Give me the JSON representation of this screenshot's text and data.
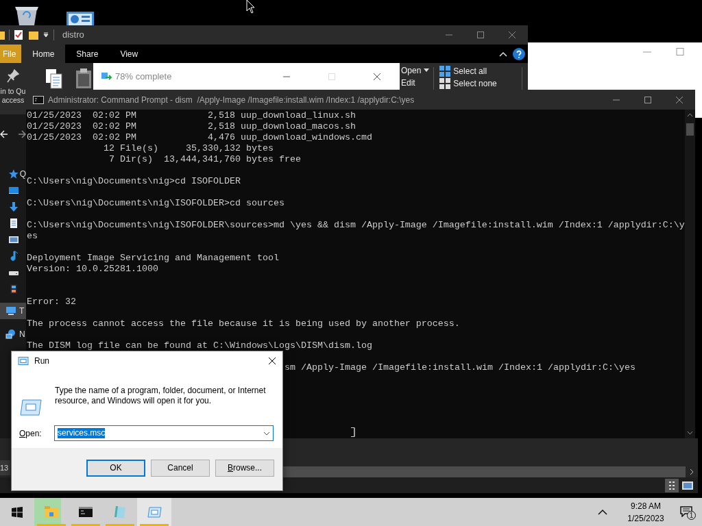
{
  "explorer": {
    "title": "distro",
    "tabs": [
      {
        "label": "File",
        "kind": "file",
        "selected": false
      },
      {
        "label": "Home",
        "kind": "tab",
        "selected": true
      },
      {
        "label": "Share",
        "kind": "tab",
        "selected": false
      },
      {
        "label": "View",
        "kind": "tab",
        "selected": false
      }
    ],
    "ribbon": {
      "pin_label": "in to Qu\naccess",
      "open": "Open",
      "edit": "Edit",
      "select_all": "Select all",
      "select_none": "Select none"
    },
    "nav_items": [
      {
        "kind": "star",
        "label": "Q",
        "selected": false
      },
      {
        "kind": "desktop",
        "selected": false
      },
      {
        "kind": "download",
        "selected": false
      },
      {
        "kind": "document",
        "selected": false
      },
      {
        "kind": "picture",
        "selected": false
      },
      {
        "kind": "music",
        "selected": false
      },
      {
        "kind": "drive",
        "selected": false
      },
      {
        "kind": "video",
        "selected": false
      },
      {
        "kind": "pc",
        "label": "T",
        "selected": true
      },
      {
        "kind": "network",
        "label": "N",
        "selected": false
      }
    ]
  },
  "file_window": {
    "item_count": "13"
  },
  "progress_dialog": {
    "title": "78% complete"
  },
  "cmd": {
    "title": "Administrator: Command Prompt - dism  /Apply-Image /Imagefile:install.wim /Index:1 /applydir:C:\\yes",
    "output": "01/25/2023  02:02 PM             2,518 uup_download_linux.sh\n01/25/2023  02:02 PM             2,518 uup_download_macos.sh\n01/25/2023  02:02 PM             4,476 uup_download_windows.cmd\n              12 File(s)     35,330,132 bytes\n               7 Dir(s)  13,444,341,760 bytes free\n\nC:\\Users\\nig\\Documents\\nig>cd ISOFOLDER\n\nC:\\Users\\nig\\Documents\\nig\\ISOFOLDER>cd sources\n\nC:\\Users\\nig\\Documents\\nig\\ISOFOLDER\\sources>md \\yes && dism /Apply-Image /Imagefile:install.wim /Index:1 /applydir:C:\\y\nes\n\nDeployment Image Servicing and Management tool\nVersion: 10.0.25281.1000\n\n\nError: 32\n\nThe process cannot access the file because it is being used by another process.\n\nThe DISM log file can be found at C:\\Windows\\Logs\\DISM\\dism.log",
    "tail": "sm /Apply-Image /Imagefile:install.wim /Index:1 /applydir:C:\\yes"
  },
  "run_dialog": {
    "title": "Run",
    "description": "Type the name of a program, folder, document, or Internet resource, and Windows will open it for you.",
    "open_label": "Open:",
    "value": "services.msc",
    "buttons": [
      {
        "label": "OK",
        "kind": "default"
      },
      {
        "label": "Cancel",
        "kind": "normal"
      },
      {
        "label": "Browse...",
        "kind": "normal"
      }
    ]
  },
  "taskbar": {
    "tasks": [
      {
        "kind": "explorer",
        "level": 0.78,
        "selected": false
      },
      {
        "kind": "cmd",
        "selected": false
      },
      {
        "kind": "notepad",
        "selected": false
      },
      {
        "kind": "run",
        "selected": true
      }
    ],
    "time": "9:28 AM",
    "date": "1/25/2023",
    "notifications": "1"
  }
}
